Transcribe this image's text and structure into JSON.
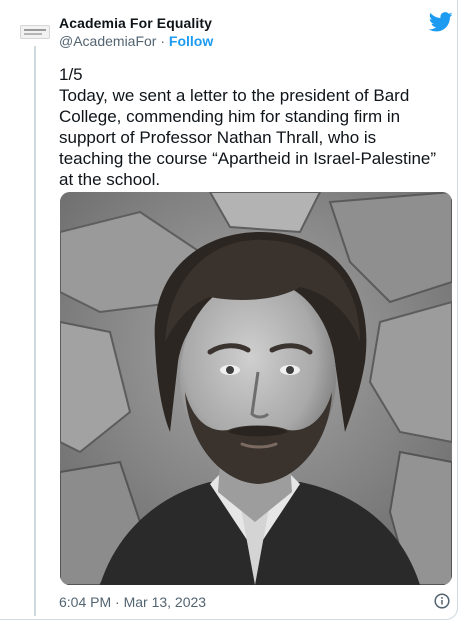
{
  "author": {
    "display_name": "Academia For Equality",
    "handle": "@AcademiaFor",
    "separator": " · ",
    "follow_label": "Follow"
  },
  "tweet": {
    "counter": "1/5",
    "text": "Today, we sent a letter to the president of Bard College, commending him for standing firm in support of Professor Nathan Thrall, who is teaching the course “Apartheid in Israel-Palestine” at the school.",
    "timestamp": "6:04 PM · Mar 13, 2023"
  },
  "icons": {
    "brand": "twitter-bird-icon",
    "info": "info-icon"
  },
  "colors": {
    "accent": "#1d9bf0",
    "text_primary": "#0f1419",
    "text_secondary": "#536471",
    "border": "#cfd9de"
  }
}
